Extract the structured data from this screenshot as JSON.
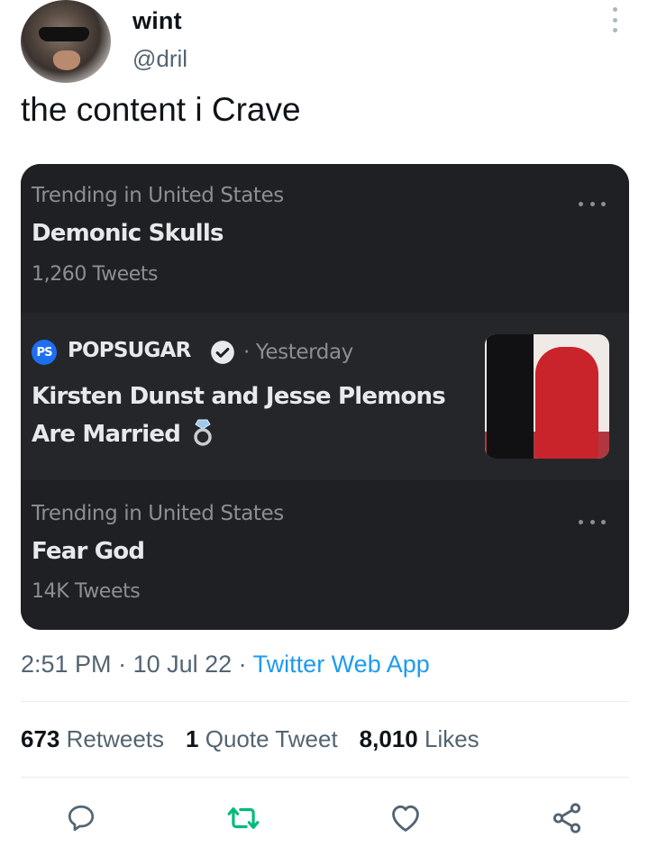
{
  "author": {
    "display_name": "wint",
    "handle": "@dril"
  },
  "tweet": {
    "text": "the content i Crave"
  },
  "card": {
    "trend1": {
      "context": "Trending in United States",
      "title": "Demonic Skulls",
      "count": "1,260 Tweets"
    },
    "news": {
      "logo_text": "PS",
      "publisher": "POPSUGAR",
      "time": "· Yesterday",
      "headline": "Kirsten Dunst and Jesse Plemons Are Married"
    },
    "trend2": {
      "context": "Trending in United States",
      "title": "Fear God",
      "count": "14K Tweets"
    }
  },
  "meta": {
    "time": "2:51 PM",
    "date": "10 Jul 22",
    "separator": " · ",
    "app": "Twitter Web App"
  },
  "stats": {
    "retweets_count": "673",
    "retweets_label": "Retweets",
    "quotes_count": "1",
    "quotes_label": "Quote Tweet",
    "likes_count": "8,010",
    "likes_label": "Likes"
  },
  "icons": {
    "reply": "reply-icon",
    "retweet": "retweet-icon",
    "like": "heart-icon",
    "share": "share-icon",
    "more": "more-icon"
  },
  "colors": {
    "link": "#1d9bf0",
    "retweet": "#00ba7c",
    "card_bg": "#1e1f24"
  }
}
